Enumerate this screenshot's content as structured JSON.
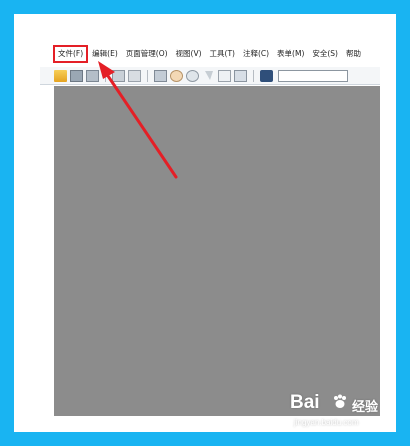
{
  "menubar": {
    "items": [
      {
        "label": "文件(F)",
        "highlighted": true
      },
      {
        "label": "编辑(E)"
      },
      {
        "label": "页面管理(O)"
      },
      {
        "label": "视图(V)"
      },
      {
        "label": "工具(T)"
      },
      {
        "label": "注释(C)"
      },
      {
        "label": "表单(M)"
      },
      {
        "label": "安全(S)"
      },
      {
        "label": "帮助"
      }
    ]
  },
  "toolbar": {
    "icons": [
      "open-icon",
      "save-icon",
      "save-as-icon",
      "print-icon",
      "print-preview-icon",
      "monitor-icon",
      "hand-icon",
      "zoom-icon",
      "select-cursor-icon",
      "document-icon",
      "image-icon",
      "binoculars-icon"
    ],
    "search_value": ""
  },
  "annotation": {
    "color": "#e41f26"
  },
  "watermark": {
    "brand_left": "Bai",
    "brand_right": "经验",
    "url": "jingyan.baidu.com"
  },
  "colors": {
    "frame": "#19b4f2",
    "document_area": "#8c8c8c",
    "highlight": "#e41f26"
  }
}
